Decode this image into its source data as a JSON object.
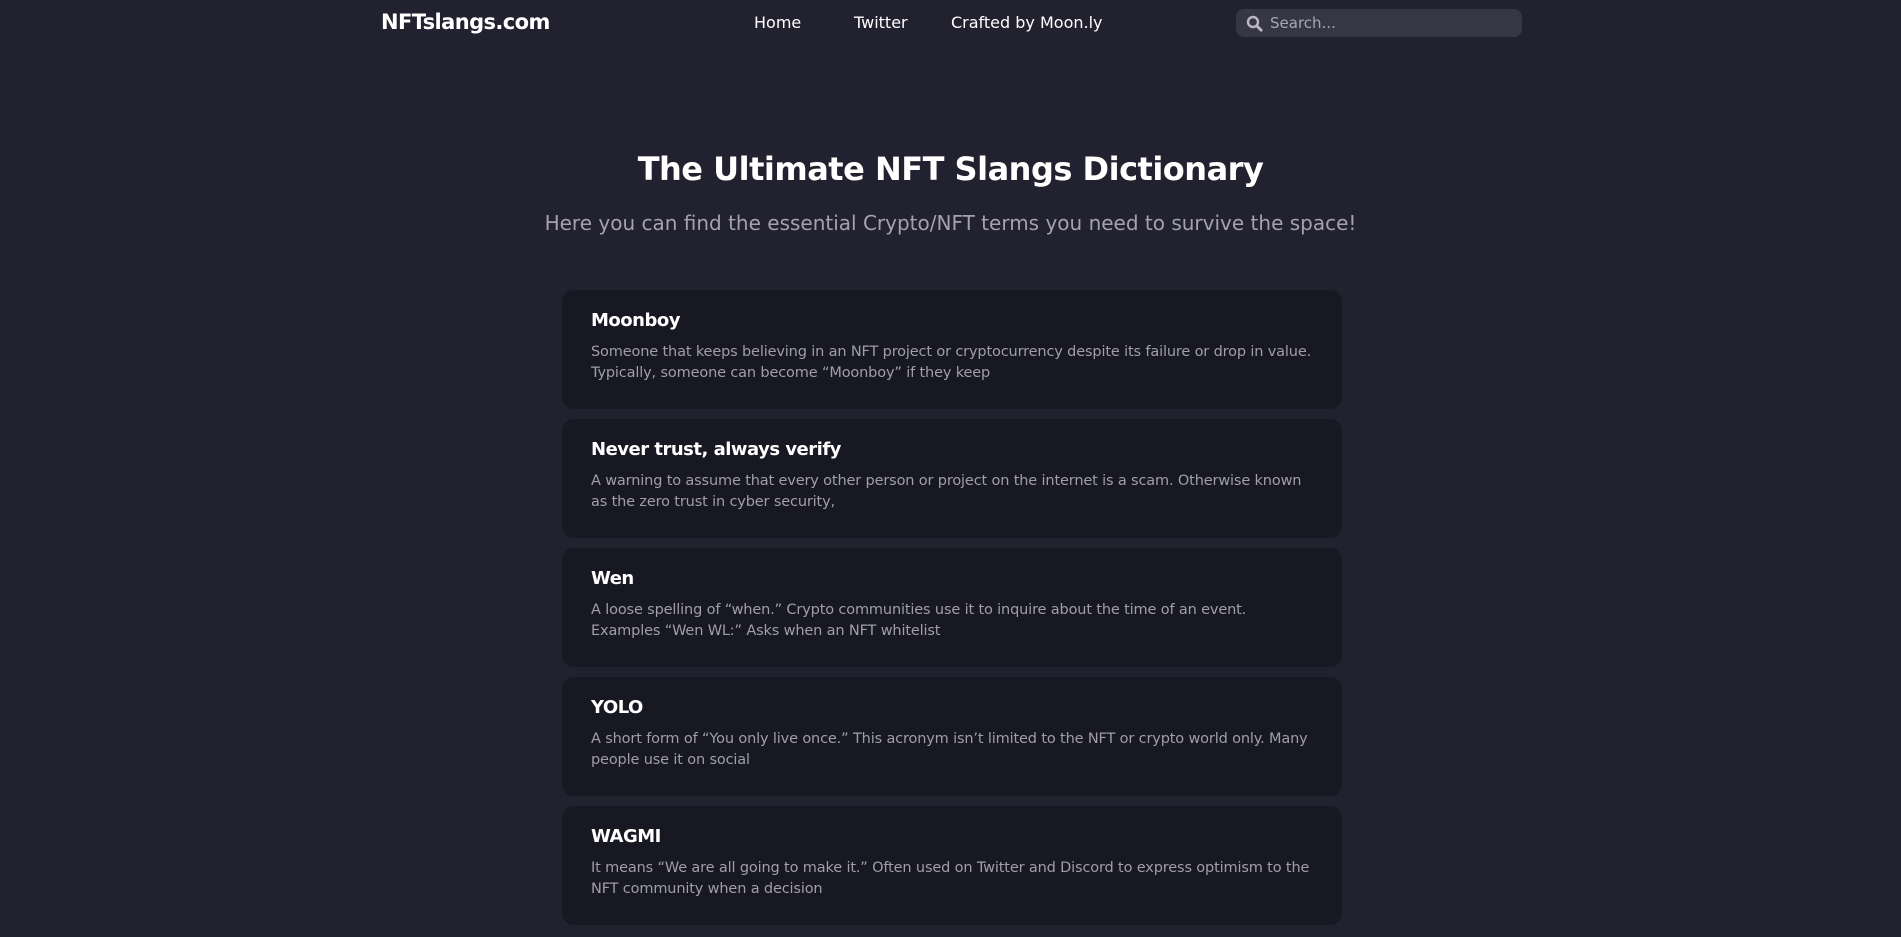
{
  "header": {
    "logo": "NFTslangs.com",
    "nav": {
      "home": "Home",
      "twitter": "Twitter",
      "crafted": "Crafted by Moon.ly"
    },
    "search": {
      "placeholder": "Search...",
      "value": "",
      "icon": "search-icon"
    }
  },
  "hero": {
    "title": "The Ultimate NFT Slangs Dictionary",
    "subtitle": "Here you can find the essential Crypto/NFT terms you need to survive the space!"
  },
  "terms": [
    {
      "title": "Moonboy",
      "description": "Someone that keeps believing in an NFT project or cryptocurrency despite its failure or drop in value. Typically, someone can become “Moonboy” if they keep"
    },
    {
      "title": "Never trust, always verify",
      "description": "A warning to assume that every other person or project on the internet is a scam. Otherwise known as the zero trust in cyber security,"
    },
    {
      "title": "Wen",
      "description": "A loose spelling of “when.” Crypto communities use it to inquire about the time of an event. Examples “Wen WL:” Asks when an NFT whitelist"
    },
    {
      "title": "YOLO",
      "description": "A short form of “You only live once.” This acronym isn’t limited to the NFT or crypto world only. Many people use it on social"
    },
    {
      "title": "WAGMI",
      "description": "It means “We are all going to make it.” Often used on Twitter and Discord to express optimism to the NFT community when a decision"
    }
  ],
  "colors": {
    "background": "#22212f",
    "card": "#181823",
    "search_bg": "#373645",
    "muted_text": "#9f9ea9"
  }
}
